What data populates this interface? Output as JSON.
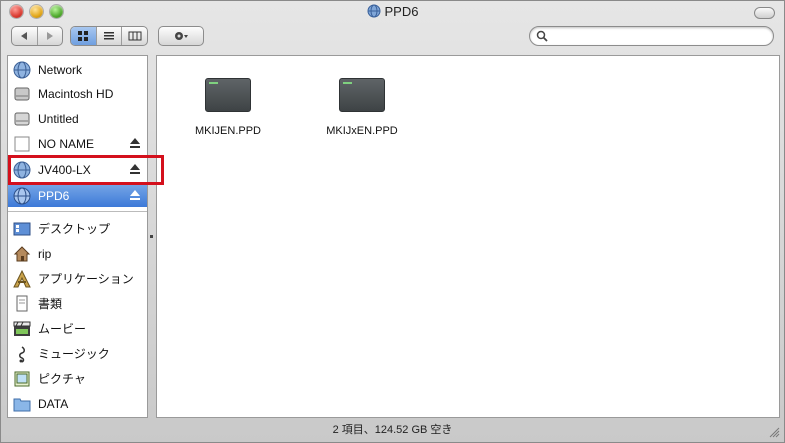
{
  "window": {
    "title": "PPD6"
  },
  "toolbar": {
    "back_label": "◀",
    "forward_label": "▶",
    "view_icons": "icon-view-icon",
    "view_list": "list-view-icon",
    "view_columns": "column-view-icon",
    "action": "gear-icon",
    "search": {
      "value": "",
      "placeholder": ""
    }
  },
  "sidebar": {
    "items": [
      {
        "label": "Network",
        "icon": "network-globe-icon",
        "eject": false
      },
      {
        "label": "Macintosh HD",
        "icon": "hard-disk-icon",
        "eject": false
      },
      {
        "label": "Untitled",
        "icon": "disk-icon",
        "eject": false
      },
      {
        "label": "NO NAME",
        "icon": "blank-disk-icon",
        "eject": true
      },
      {
        "label": "JV400-LX",
        "icon": "network-globe-icon",
        "eject": true
      },
      {
        "label": "PPD6",
        "icon": "network-globe-icon",
        "eject": true,
        "selected": true
      },
      {
        "label": "デスクトップ",
        "icon": "desktop-icon",
        "eject": false
      },
      {
        "label": "rip",
        "icon": "home-icon",
        "eject": false
      },
      {
        "label": "アプリケーション",
        "icon": "applications-icon",
        "eject": false
      },
      {
        "label": "書類",
        "icon": "documents-icon",
        "eject": false
      },
      {
        "label": "ムービー",
        "icon": "movies-icon",
        "eject": false
      },
      {
        "label": "ミュージック",
        "icon": "music-icon",
        "eject": false
      },
      {
        "label": "ピクチャ",
        "icon": "pictures-icon",
        "eject": false
      },
      {
        "label": "DATA",
        "icon": "folder-icon",
        "eject": false
      }
    ]
  },
  "files": [
    {
      "name": "MKIJEN.PPD",
      "icon": "ppd-file-icon"
    },
    {
      "name": "MKIJxEN.PPD",
      "icon": "ppd-file-icon"
    }
  ],
  "status": {
    "text": "2 項目、124.52 GB 空き"
  },
  "colors": {
    "selection": "#3d79d8",
    "highlight": "#d4101c"
  }
}
